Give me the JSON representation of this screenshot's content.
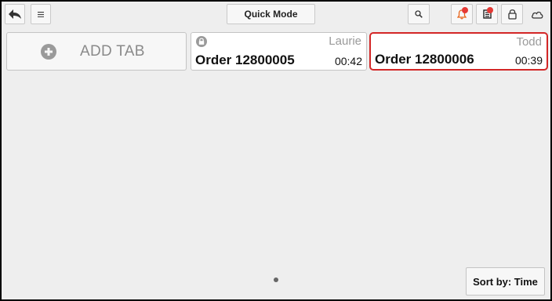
{
  "toolbar": {
    "back_icon": "back-arrow-icon",
    "menu_icon": "hamburger-menu-icon",
    "quick_mode_label": "Quick Mode",
    "search_icon": "search-icon",
    "notifications_icon": "bell-icon",
    "notifications_color": "#e53935",
    "tickets_icon": "receipt-list-icon",
    "lock_icon": "lock-icon",
    "cloud_icon": "cloud-icon"
  },
  "tabs": {
    "add_tab_label": "ADD TAB",
    "add_tab_icon": "plus-circle-icon",
    "orders": [
      {
        "user": "Laurie",
        "number": "Order 12800005",
        "time": "00:42",
        "locked": true,
        "selected": false
      },
      {
        "user": "Todd",
        "number": "Order 12800006",
        "time": "00:39",
        "locked": false,
        "selected": true
      }
    ],
    "selected_border_color": "#d32626"
  },
  "footer": {
    "sort_label": "Sort by: Time",
    "page_indicator": {
      "current": 1,
      "total": 1
    }
  }
}
